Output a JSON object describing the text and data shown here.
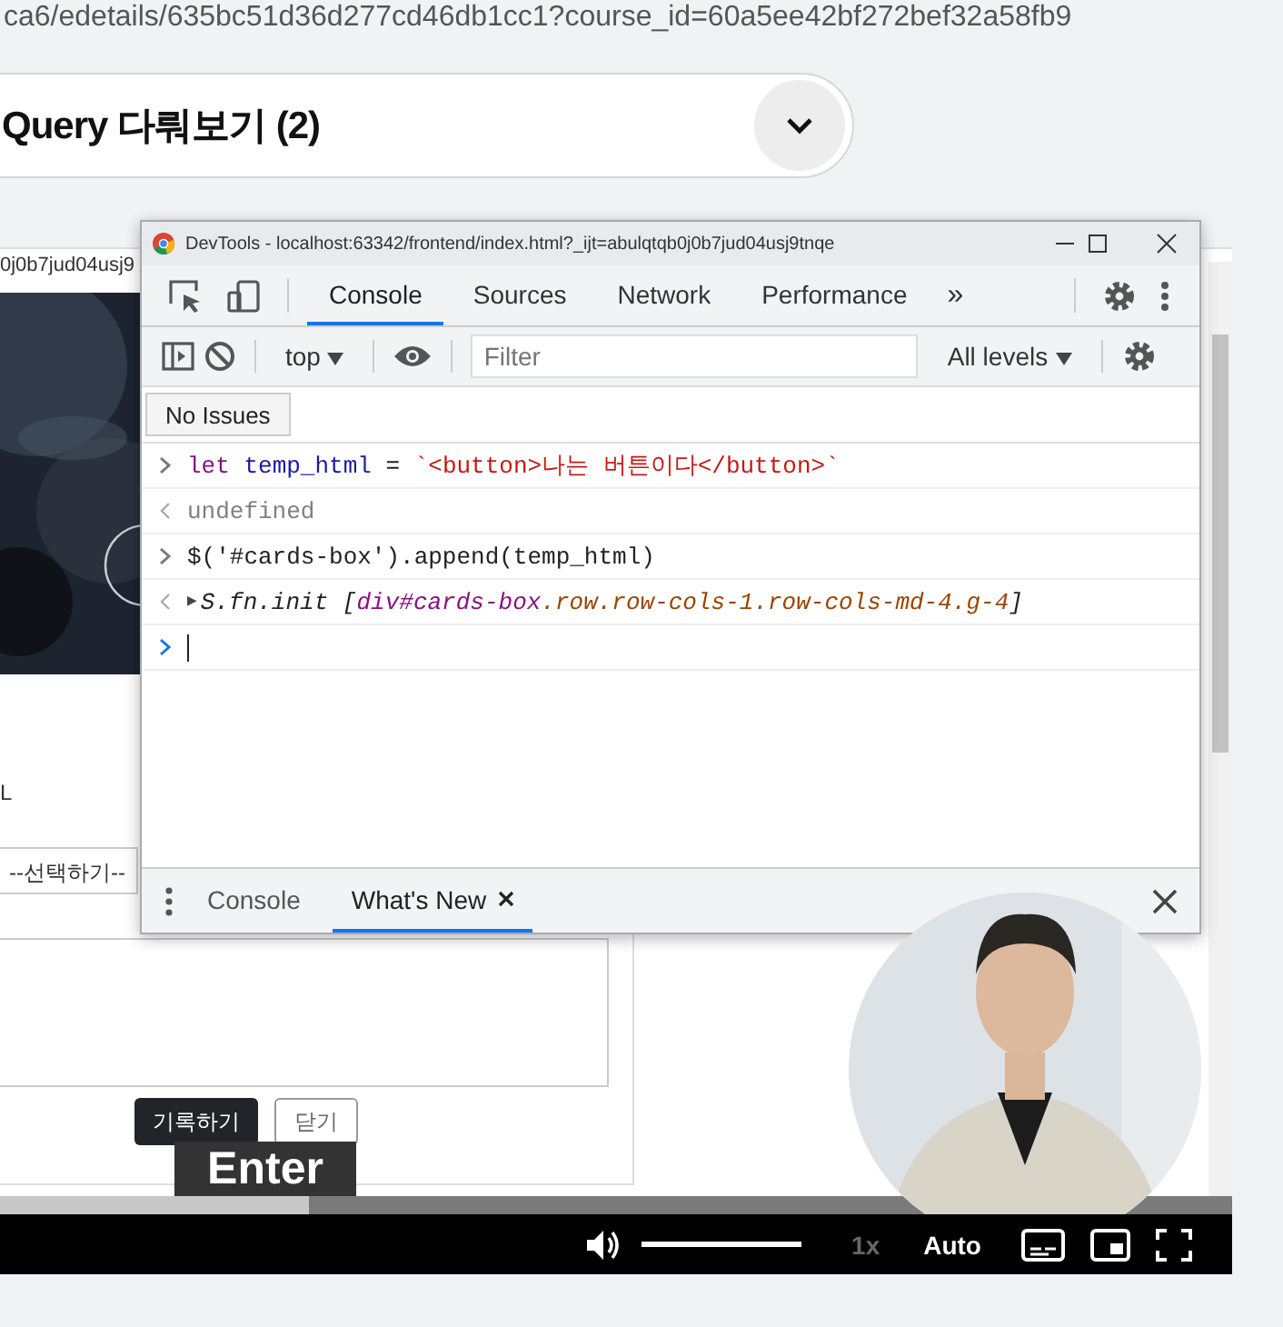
{
  "url_text": "ca6/edetails/635bc51d36d277cd46db1cc1?course_id=60a5ee42bf272bef32a58fb9",
  "lesson": {
    "title": "Query 다뤄보기 (2)",
    "expanded": false
  },
  "video": {
    "page": {
      "address_fragment": "0j0b7jud04usj9",
      "field_label": "L",
      "select_value": "--선택하기--",
      "buttons": [
        {
          "label": "기록하기",
          "kind": "primary"
        },
        {
          "label": "닫기",
          "kind": "outline"
        }
      ]
    },
    "devtools": {
      "title": "DevTools - localhost:63342/frontend/index.html?_ijt=abulqtqb0j0b7jud04usj9tnqe",
      "tabs": [
        {
          "label": "Console",
          "selected": true
        },
        {
          "label": "Sources",
          "selected": false
        },
        {
          "label": "Network",
          "selected": false
        },
        {
          "label": "Performance",
          "selected": false
        }
      ],
      "more_tabs": "»",
      "context": "top",
      "filter_placeholder": "Filter",
      "levels": "All levels",
      "issues_button": "No Issues",
      "lines": [
        {
          "kind": "input",
          "tokens": [
            {
              "kind": "keyword",
              "text": "let "
            },
            {
              "kind": "variable",
              "text": "temp_html"
            },
            {
              "kind": "plain",
              "text": " = "
            },
            {
              "kind": "string",
              "text": "`<button>나는 버튼이다</button>`"
            }
          ]
        },
        {
          "kind": "result",
          "tokens": [
            {
              "kind": "muted",
              "text": "undefined"
            }
          ]
        },
        {
          "kind": "input",
          "tokens": [
            {
              "kind": "plain",
              "text": "$('#cards-box').append(temp_html)"
            }
          ]
        },
        {
          "kind": "object",
          "expand": "▶",
          "tokens": [
            {
              "kind": "italic",
              "text": "S.fn.init ["
            },
            {
              "kind": "node",
              "text": "div#cards-box"
            },
            {
              "kind": "attr",
              "text": ".row.row-cols-1.row-cols-md-4.g-4"
            },
            {
              "kind": "italic",
              "text": "]"
            }
          ]
        },
        {
          "kind": "prompt"
        }
      ],
      "drawer_tabs": [
        {
          "label": "Console",
          "selected": false,
          "closable": false
        },
        {
          "label": "What's New",
          "selected": true,
          "closable": true
        }
      ]
    },
    "key_overlay": "Enter",
    "progress": {
      "level": 0.25
    },
    "controls": {
      "volume": {
        "level": 1
      },
      "speed": "1x",
      "quality": "Auto"
    }
  }
}
